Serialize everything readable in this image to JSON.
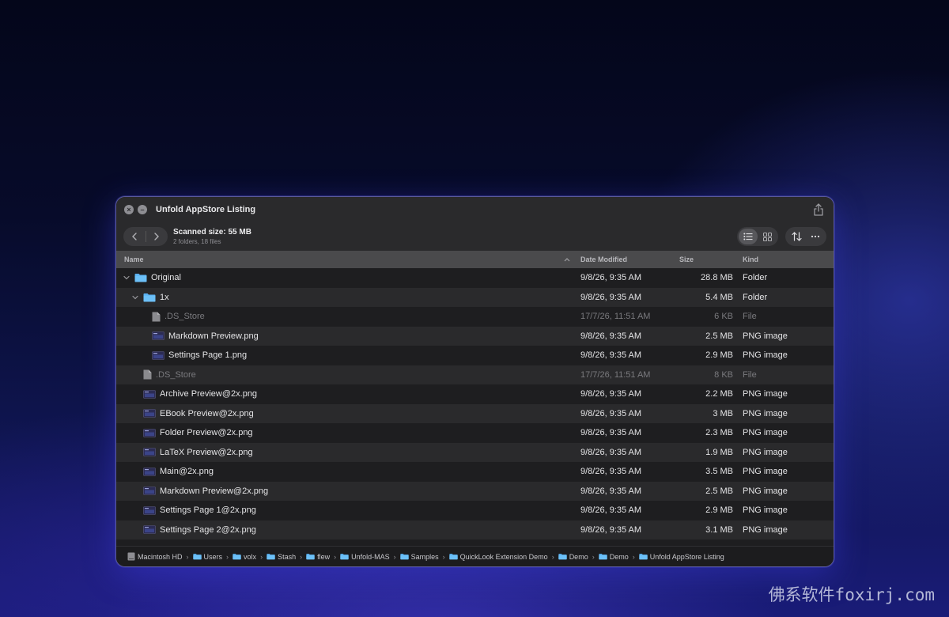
{
  "window": {
    "title": "Unfold AppStore Listing",
    "close_label": "×",
    "minimize_label": "–"
  },
  "toolbar": {
    "scanned_size": "Scanned size: 55 MB",
    "summary": "2 folders, 18 files",
    "view_list_icon": "list-view-icon",
    "view_grid_icon": "grid-view-icon",
    "sort_icon": "sort-arrows-icon",
    "more_icon": "ellipsis-icon"
  },
  "columns": {
    "name": "Name",
    "date": "Date Modified",
    "size": "Size",
    "kind": "Kind"
  },
  "rows": [
    {
      "name": "Original",
      "date": "9/8/26, 9:35 AM",
      "size": "28.8 MB",
      "kind": "Folder",
      "type": "folder",
      "depth": 0,
      "expanded": true
    },
    {
      "name": "1x",
      "date": "9/8/26, 9:35 AM",
      "size": "5.4 MB",
      "kind": "Folder",
      "type": "folder",
      "depth": 1,
      "expanded": true
    },
    {
      "name": ".DS_Store",
      "date": "17/7/26, 11:51 AM",
      "size": "6 KB",
      "kind": "File",
      "type": "file",
      "depth": 2,
      "dim": true
    },
    {
      "name": "Markdown Preview.png",
      "date": "9/8/26, 9:35 AM",
      "size": "2.5 MB",
      "kind": "PNG image",
      "type": "image",
      "depth": 2
    },
    {
      "name": "Settings Page 1.png",
      "date": "9/8/26, 9:35 AM",
      "size": "2.9 MB",
      "kind": "PNG image",
      "type": "image",
      "depth": 2
    },
    {
      "name": ".DS_Store",
      "date": "17/7/26, 11:51 AM",
      "size": "8 KB",
      "kind": "File",
      "type": "file",
      "depth": 1,
      "dim": true
    },
    {
      "name": "Archive Preview@2x.png",
      "date": "9/8/26, 9:35 AM",
      "size": "2.2 MB",
      "kind": "PNG image",
      "type": "image",
      "depth": 1
    },
    {
      "name": "EBook Preview@2x.png",
      "date": "9/8/26, 9:35 AM",
      "size": "3 MB",
      "kind": "PNG image",
      "type": "image",
      "depth": 1
    },
    {
      "name": "Folder Preview@2x.png",
      "date": "9/8/26, 9:35 AM",
      "size": "2.3 MB",
      "kind": "PNG image",
      "type": "image",
      "depth": 1
    },
    {
      "name": "LaTeX Preview@2x.png",
      "date": "9/8/26, 9:35 AM",
      "size": "1.9 MB",
      "kind": "PNG image",
      "type": "image",
      "depth": 1
    },
    {
      "name": "Main@2x.png",
      "date": "9/8/26, 9:35 AM",
      "size": "3.5 MB",
      "kind": "PNG image",
      "type": "image",
      "depth": 1
    },
    {
      "name": "Markdown Preview@2x.png",
      "date": "9/8/26, 9:35 AM",
      "size": "2.5 MB",
      "kind": "PNG image",
      "type": "image",
      "depth": 1
    },
    {
      "name": "Settings Page 1@2x.png",
      "date": "9/8/26, 9:35 AM",
      "size": "2.9 MB",
      "kind": "PNG image",
      "type": "image",
      "depth": 1
    },
    {
      "name": "Settings Page 2@2x.png",
      "date": "9/8/26, 9:35 AM",
      "size": "3.1 MB",
      "kind": "PNG image",
      "type": "image",
      "depth": 1
    }
  ],
  "path": [
    {
      "label": "Macintosh HD",
      "type": "disk"
    },
    {
      "label": "Users",
      "type": "folder"
    },
    {
      "label": "volx",
      "type": "folder"
    },
    {
      "label": "Stash",
      "type": "folder"
    },
    {
      "label": "flew",
      "type": "folder"
    },
    {
      "label": "Unfold-MAS",
      "type": "folder"
    },
    {
      "label": "Samples",
      "type": "folder"
    },
    {
      "label": "QuickLook Extension Demo",
      "type": "folder"
    },
    {
      "label": "Demo",
      "type": "folder"
    },
    {
      "label": "Demo",
      "type": "folder"
    },
    {
      "label": "Unfold AppStore Listing",
      "type": "folder"
    }
  ],
  "colors": {
    "folder": "#5ab0f0",
    "accent_border": "#8c8cff"
  },
  "watermark": "佛系软件foxirj.com"
}
